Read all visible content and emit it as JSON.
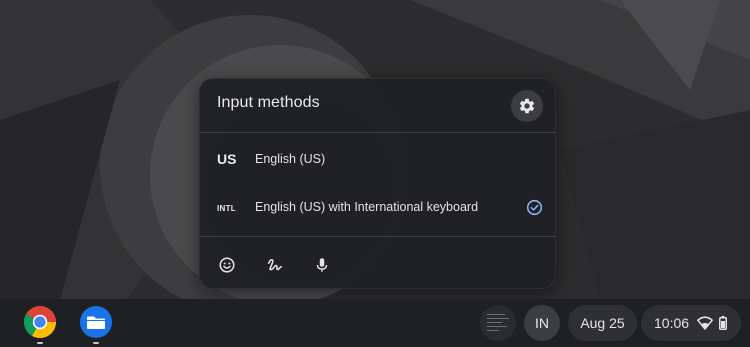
{
  "popup": {
    "title": "Input methods",
    "methods": [
      {
        "code": "US",
        "name": "English (US)",
        "selected": false
      },
      {
        "code": "INTL",
        "name": "English (US) with International keyboard",
        "selected": true
      }
    ],
    "tools": [
      "emoji-icon",
      "handwriting-icon",
      "microphone-icon"
    ]
  },
  "shelf": {
    "apps": [
      "chrome-icon",
      "files-icon"
    ],
    "ime_indicator": "IN",
    "date": "Aug 25",
    "time": "10:06"
  },
  "colors": {
    "accent": "#8ab4f8",
    "files_blue": "#1a73e8"
  }
}
